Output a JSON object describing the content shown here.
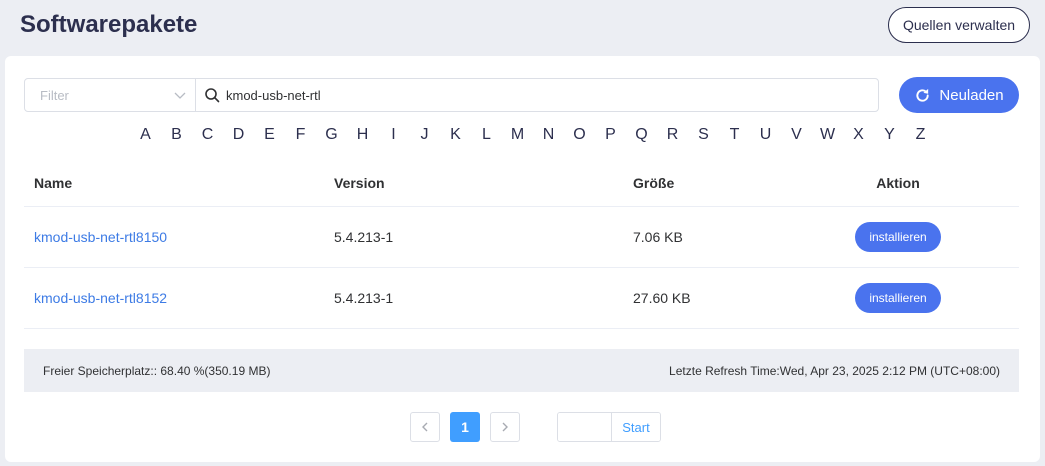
{
  "header": {
    "title": "Softwarepakete",
    "sources_button": "Quellen verwalten"
  },
  "toolbar": {
    "filter_placeholder": "Filter",
    "search_value": "kmod-usb-net-rtl",
    "reload_label": "Neuladen"
  },
  "alphabet": [
    "A",
    "B",
    "C",
    "D",
    "E",
    "F",
    "G",
    "H",
    "I",
    "J",
    "K",
    "L",
    "M",
    "N",
    "O",
    "P",
    "Q",
    "R",
    "S",
    "T",
    "U",
    "V",
    "W",
    "X",
    "Y",
    "Z"
  ],
  "table": {
    "headers": {
      "name": "Name",
      "version": "Version",
      "size": "Größe",
      "action": "Aktion"
    },
    "rows": [
      {
        "name": "kmod-usb-net-rtl8150",
        "version": "5.4.213-1",
        "size": "7.06 KB",
        "action": "installieren"
      },
      {
        "name": "kmod-usb-net-rtl8152",
        "version": "5.4.213-1",
        "size": "27.60 KB",
        "action": "installieren"
      }
    ]
  },
  "footer": {
    "free_space": "Freier Speicherplatz:: 68.40 %(350.19 MB)",
    "refresh_time": "Letzte Refresh Time:Wed, Apr 23, 2025 2:12 PM (UTC+08:00)"
  },
  "pagination": {
    "current_page": "1",
    "jump_label": "Start"
  },
  "colors": {
    "accent": "#4a73ee",
    "link": "#3d7be5",
    "page_bg": "#eceef3"
  }
}
